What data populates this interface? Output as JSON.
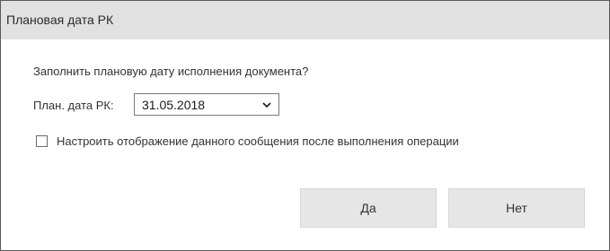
{
  "window": {
    "title": "Плановая дата РК"
  },
  "body": {
    "question": "Заполнить плановую дату исполнения документа?",
    "date_label": "План. дата РК:",
    "date_value": "31.05.2018",
    "checkbox_label": "Настроить отображение данного сообщения после выполнения операции",
    "checkbox_checked": false
  },
  "buttons": {
    "yes_label": "Да",
    "no_label": "Нет"
  },
  "colors": {
    "titlebar_bg": "#e1e1e1",
    "button_bg": "#e6e6e6",
    "border": "#5a5a5a"
  }
}
